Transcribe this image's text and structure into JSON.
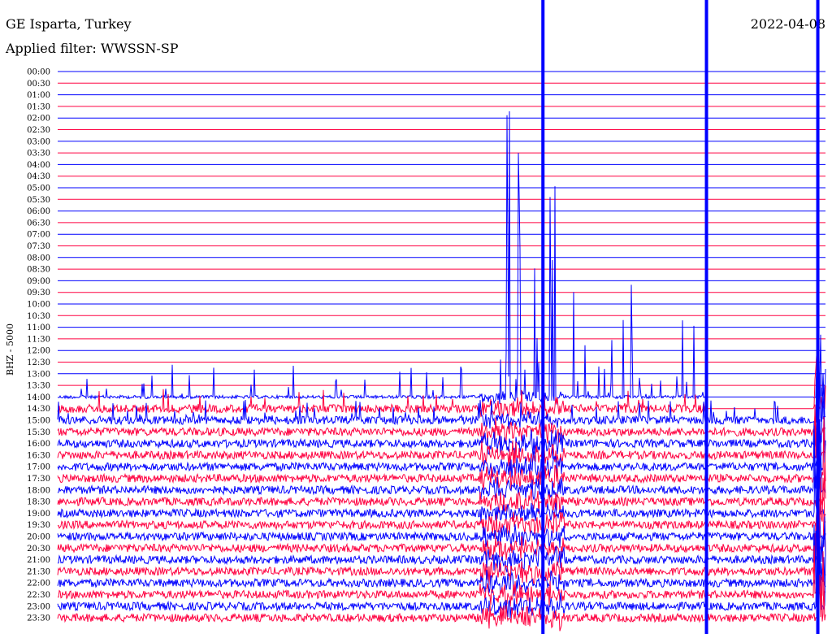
{
  "header": {
    "station": "GE Isparta, Turkey",
    "filter": "Applied filter: WWSSN-SP",
    "date": "2022-04-08"
  },
  "chart_data": {
    "type": "line",
    "title": "GE Isparta, Turkey",
    "ylabel": "BHZ - 5000",
    "row_labels": [
      "00:00",
      "00:30",
      "01:00",
      "01:30",
      "02:00",
      "02:30",
      "03:00",
      "03:30",
      "04:00",
      "04:30",
      "05:00",
      "05:30",
      "06:00",
      "06:30",
      "07:00",
      "07:30",
      "08:00",
      "08:30",
      "09:00",
      "09:30",
      "10:00",
      "10:30",
      "11:00",
      "11:30",
      "12:00",
      "12:30",
      "13:00",
      "13:30",
      "14:00",
      "14:30",
      "15:00",
      "15:30",
      "16:00",
      "16:30",
      "17:00",
      "17:30",
      "18:00",
      "18:30",
      "19:00",
      "19:30",
      "20:00",
      "20:30",
      "21:00",
      "21:30",
      "22:00",
      "22:30",
      "23:00",
      "23:30"
    ],
    "minutes_per_row": 30,
    "first_active_row": "14:30",
    "event_window_fraction": [
      0.57,
      0.66
    ],
    "marker_fractions": [
      0.632,
      0.845,
      0.99
    ],
    "colors": {
      "hour": "#0000ff",
      "half_hour": "#ff0040",
      "marker": "#0000ff"
    }
  }
}
